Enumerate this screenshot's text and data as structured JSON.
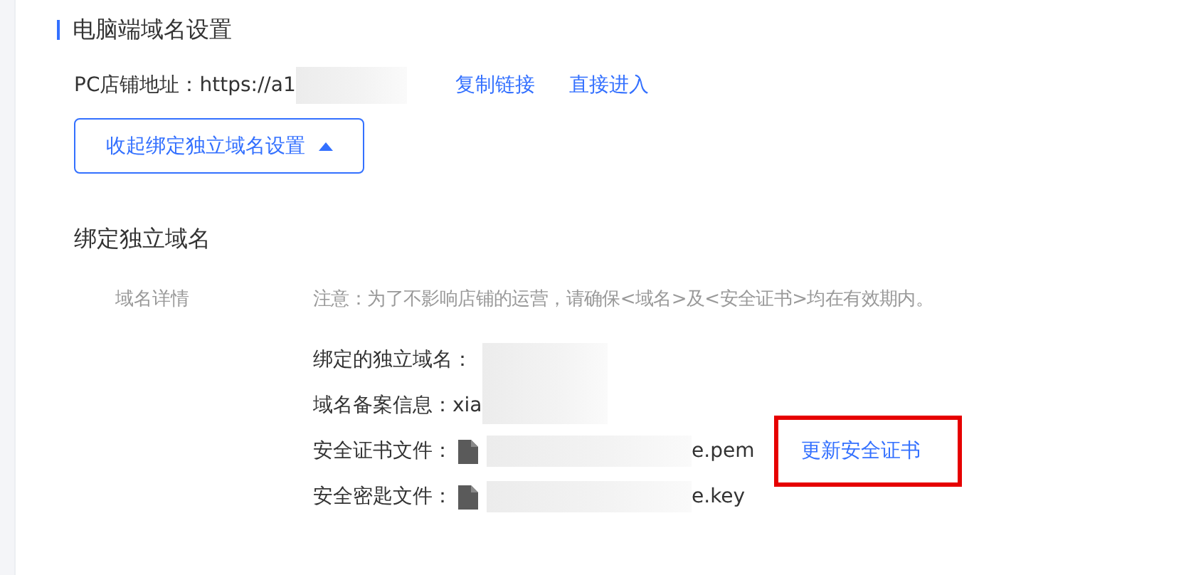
{
  "section_title": "电脑端域名设置",
  "pc_address": {
    "label": "PC店铺地址：",
    "value": "https://a1"
  },
  "links": [
    "复制链接",
    "直接进入"
  ],
  "collapse_button": {
    "label": "收起绑定独立域名设置",
    "expanded": true
  },
  "bind_title": "绑定独立域名",
  "detail_label": "域名详情",
  "notice": "注意：为了不影响店铺的运营，请确保<域名>及<安全证书>均在有效期内。",
  "fields": [
    {
      "kind": "text",
      "label": "绑定的独立域名："
    },
    {
      "kind": "text",
      "label": "域名备案信息：",
      "value": "xia"
    },
    {
      "kind": "file",
      "label": "安全证书文件：",
      "value": "e.pem",
      "action": "更新安全证书",
      "highlighted": true
    },
    {
      "kind": "file",
      "label": "安全密匙文件：",
      "value": "e.key"
    }
  ]
}
